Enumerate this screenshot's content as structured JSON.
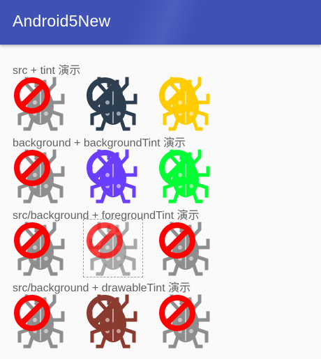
{
  "app_bar": {
    "title": "Android5New",
    "color": "#3f51b5"
  },
  "sections": [
    {
      "title": "src + tint 演示",
      "icons": [
        {
          "icon": "bug-icon",
          "bug_color": "#8e8e8e",
          "bug_opacity": 1,
          "no_sign_color": "#ff0000",
          "no_sign_opacity": 1,
          "state": "normal"
        },
        {
          "icon": "bug-icon",
          "bug_color": "#2c3e50",
          "bug_opacity": 1,
          "no_sign_color": "#2c3e50",
          "no_sign_opacity": 1,
          "state": "normal"
        },
        {
          "icon": "bug-icon",
          "bug_color": "#ffcc00",
          "bug_opacity": 1,
          "no_sign_color": "#ffcc00",
          "no_sign_opacity": 1,
          "state": "normal"
        }
      ]
    },
    {
      "title": "background + backgroundTint 演示",
      "icons": [
        {
          "icon": "bug-icon",
          "bug_color": "#8e8e8e",
          "bug_opacity": 1,
          "no_sign_color": "#ff0000",
          "no_sign_opacity": 1,
          "state": "normal"
        },
        {
          "icon": "bug-icon",
          "bug_color": "#6a3dff",
          "bug_opacity": 1,
          "no_sign_color": "#6a3dff",
          "no_sign_opacity": 1,
          "state": "normal"
        },
        {
          "icon": "bug-icon",
          "bug_color": "#00ff33",
          "bug_opacity": 1,
          "no_sign_color": "#00ff33",
          "no_sign_opacity": 1,
          "state": "normal"
        }
      ]
    },
    {
      "title": "src/background + foregroundTint 演示",
      "icons": [
        {
          "icon": "bug-icon",
          "bug_color": "#8e8e8e",
          "bug_opacity": 1,
          "no_sign_color": "#ff0000",
          "no_sign_opacity": 1,
          "state": "normal"
        },
        {
          "icon": "bug-icon",
          "bug_color": "#8e8e8e",
          "bug_opacity": 0.75,
          "no_sign_color": "#ff0000",
          "no_sign_opacity": 0.75,
          "state": "focused"
        },
        {
          "icon": "bug-icon",
          "bug_color": "#8e8e8e",
          "bug_opacity": 1,
          "no_sign_color": "#ff0000",
          "no_sign_opacity": 1,
          "state": "normal"
        }
      ]
    },
    {
      "title": "src/background + drawableTint 演示",
      "icons": [
        {
          "icon": "bug-icon",
          "bug_color": "#8e8e8e",
          "bug_opacity": 1,
          "no_sign_color": "#ff0000",
          "no_sign_opacity": 1,
          "state": "normal"
        },
        {
          "icon": "bug-icon",
          "bug_color": "#8b3a2f",
          "bug_opacity": 1,
          "no_sign_color": "#8b3a2f",
          "no_sign_opacity": 1,
          "state": "normal"
        },
        {
          "icon": "bug-icon",
          "bug_color": "#8e8e8e",
          "bug_opacity": 1,
          "no_sign_color": "#ff0000",
          "no_sign_opacity": 1,
          "state": "normal"
        }
      ]
    }
  ]
}
